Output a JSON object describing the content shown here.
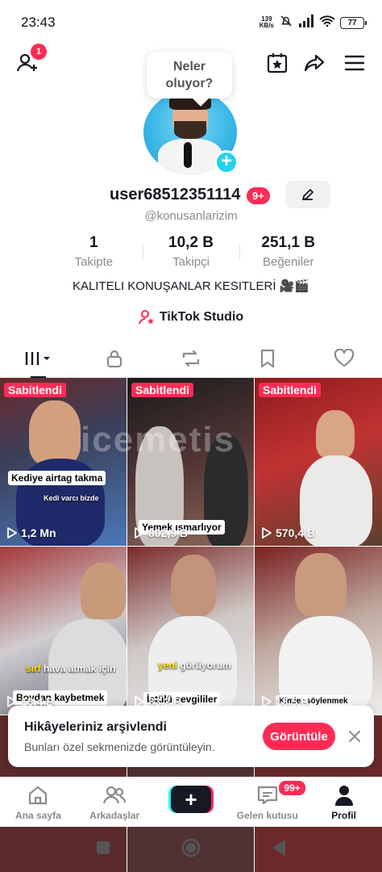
{
  "status_bar": {
    "time": "23:43",
    "net_speed_value": "139",
    "net_speed_unit": "KB/s",
    "battery": "77"
  },
  "top_nav": {
    "friend_requests_badge": "1"
  },
  "bubble": {
    "line1": "Neler",
    "line2": "oluyor?"
  },
  "profile": {
    "username": "user68512351114",
    "username_badge": "9+",
    "handle": "@konusanlarizim",
    "bio": "KALITELI KONUŞANLAR KESITLERİ 🎥🎬",
    "studio_label": "TikTok Studio"
  },
  "stats": [
    {
      "value": "1",
      "label": "Takipte"
    },
    {
      "value": "10,2 B",
      "label": "Takipçi"
    },
    {
      "value": "251,1 B",
      "label": "Beğeniler"
    }
  ],
  "videos": [
    {
      "pinned": "Sabitlendi",
      "caption": "Kediye airtag takma",
      "subtitle": "Kedi varcı bizde",
      "views": "1,2 Mn"
    },
    {
      "pinned": "Sabitlendi",
      "caption": "Yemek ısmarlıyor",
      "views": "802,9 B"
    },
    {
      "pinned": "Sabitlendi",
      "views": "570,4 B"
    },
    {
      "subtitle_hl": "sırf",
      "subtitle": "hava atmak için",
      "caption": "Boydan kaybetmek",
      "views": "13,4 B"
    },
    {
      "subtitle_hl": "yeni",
      "subtitle": "görüyorum",
      "caption": "İştülü sevgililer",
      "views": "33,2 B"
    },
    {
      "caption": "Kimler söylenmek",
      "views": "18,5 B"
    }
  ],
  "watermark": "icemetis",
  "toast": {
    "title": "Hikâyeleriniz arşivlendi",
    "subtitle": "Bunları özel sekmenizde görüntüleyin.",
    "button": "Görüntüle"
  },
  "bottom_nav": {
    "home": "Ana sayfa",
    "friends": "Arkadaşlar",
    "inbox": "Gelen kutusu",
    "inbox_badge": "99+",
    "profile": "Profil",
    "create": "+"
  },
  "colors": {
    "accent": "#fe2c55",
    "cyan": "#25f4ee",
    "text_primary": "#161823",
    "text_secondary": "#8a8b91"
  }
}
